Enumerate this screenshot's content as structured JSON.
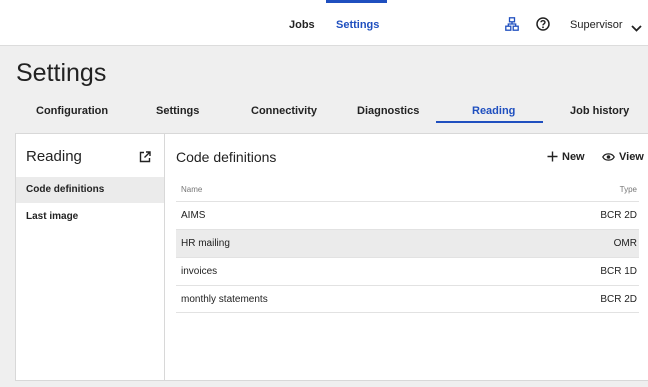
{
  "header": {
    "nav": [
      {
        "label": "Jobs",
        "active": false
      },
      {
        "label": "Settings",
        "active": true
      }
    ],
    "icons": [
      "network-icon",
      "help-icon",
      "chevron-down-icon"
    ],
    "user_label": "Supervisor",
    "accent_color": "#1f4fbf"
  },
  "page_title": "Settings",
  "tabs": [
    {
      "label": "Configuration",
      "active": false
    },
    {
      "label": "Settings",
      "active": false
    },
    {
      "label": "Connectivity",
      "active": false
    },
    {
      "label": "Diagnostics",
      "active": false
    },
    {
      "label": "Reading",
      "active": true
    },
    {
      "label": "Job history",
      "active": false
    }
  ],
  "sidebar": {
    "title": "Reading",
    "title_icon": "external-link-icon",
    "items": [
      {
        "label": "Code definitions",
        "active": true
      },
      {
        "label": "Last image",
        "active": false
      }
    ]
  },
  "main": {
    "title": "Code definitions",
    "actions": {
      "new_label": "New",
      "view_label": "View"
    },
    "columns": {
      "name": "Name",
      "type": "Type"
    },
    "rows": [
      {
        "name": "AIMS",
        "type": "BCR 2D",
        "highlight": false
      },
      {
        "name": "HR mailing",
        "type": "OMR",
        "highlight": true
      },
      {
        "name": "invoices",
        "type": "BCR 1D",
        "highlight": false
      },
      {
        "name": "monthly statements",
        "type": "BCR 2D",
        "highlight": false
      }
    ]
  }
}
